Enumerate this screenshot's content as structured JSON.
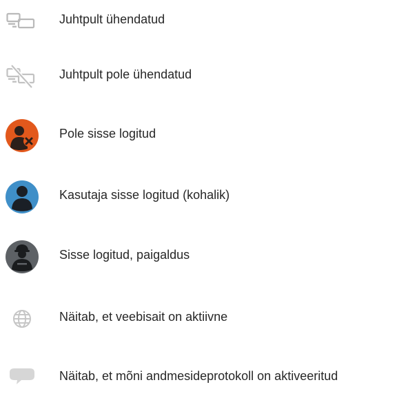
{
  "legend": {
    "items": [
      {
        "icon": "monitor-link-icon",
        "label": "Juhtpult ühendatud"
      },
      {
        "icon": "monitor-unlink-icon",
        "label": "Juhtpult pole ühendatud"
      },
      {
        "icon": "user-not-logged-in-icon",
        "label": "Pole sisse logitud",
        "color": "#e2581c"
      },
      {
        "icon": "user-local-icon",
        "label": "Kasutaja sisse logitud (kohalik)",
        "color": "#3f8fc8"
      },
      {
        "icon": "user-installer-icon",
        "label": "Sisse logitud, paigaldus",
        "color": "#5d6165"
      },
      {
        "icon": "globe-icon",
        "label": "Näitab, et veebisait on aktiivne"
      },
      {
        "icon": "speech-bubble-icon",
        "label": "Näitab, et mõni andmesideprotokoll on aktiveeritud"
      }
    ]
  }
}
